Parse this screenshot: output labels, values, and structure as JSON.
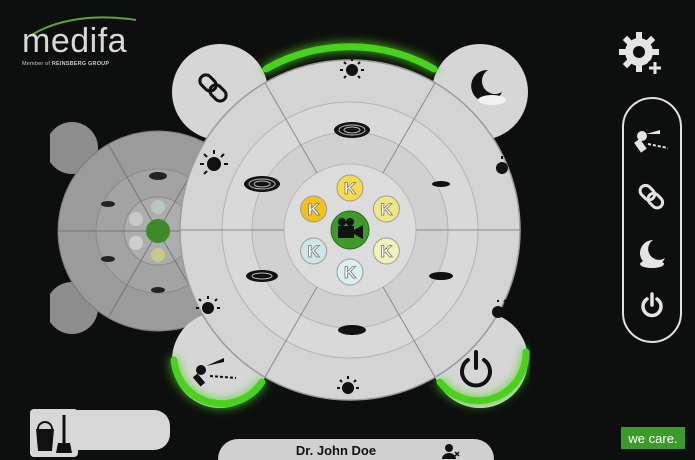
{
  "brand": {
    "logo_text": "medifa",
    "member_prefix": "Member of",
    "member_group": "REINSBERG GROUP",
    "tagline": "we care."
  },
  "colors": {
    "background": "#0d0f0e",
    "accent_green": "#4cc62a",
    "panel_grey": "#d4d4d4"
  },
  "controls": {
    "settings_icon": "gear-plus-icon",
    "side_panel": [
      "examination-light-icon",
      "link-icon",
      "night-mode-icon",
      "power-icon"
    ],
    "clean_icon": "cleaning-bucket-icon",
    "user_icon": "user-icon"
  },
  "main_dial": {
    "center_icon": "camera-icon",
    "k_buttons": [
      {
        "label": "K",
        "color": "#cfe6e6"
      },
      {
        "label": "K",
        "color": "#f2c21a"
      },
      {
        "label": "K",
        "color": "#f6d94c"
      },
      {
        "label": "K",
        "color": "#f0e682"
      },
      {
        "label": "K",
        "color": "#f4f2b6"
      },
      {
        "label": "K",
        "color": "#dbeef0"
      }
    ]
  },
  "user": {
    "name": "Dr. John Doe"
  }
}
